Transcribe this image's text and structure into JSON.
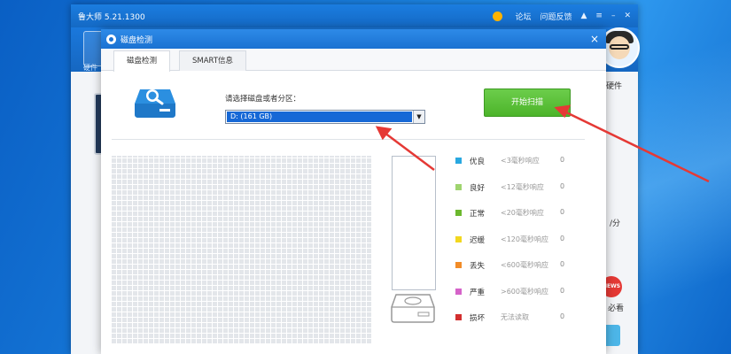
{
  "app": {
    "title": "鲁大师 5.21.1300",
    "controls": [
      "论坛",
      "问题反馈"
    ],
    "tile_label": "硬件",
    "side_texts": [
      "硬件",
      "/分",
      "必看"
    ],
    "news_label": "NEWS"
  },
  "dialog": {
    "title": "磁盘检测",
    "close": "×",
    "tabs": [
      {
        "label": "磁盘检测",
        "active": true
      },
      {
        "label": "SMART信息",
        "active": false
      }
    ],
    "select_label": "请选择磁盘或者分区：",
    "selected_disk": "D: (161 GB)",
    "scan_button": "开始扫描"
  },
  "legend": [
    {
      "name": "优良",
      "range": "<3毫秒响应",
      "count": "0",
      "color": "#29a8e0"
    },
    {
      "name": "良好",
      "range": "<12毫秒响应",
      "count": "0",
      "color": "#9fd46f"
    },
    {
      "name": "正常",
      "range": "<20毫秒响应",
      "count": "0",
      "color": "#6cb82e"
    },
    {
      "name": "迟缓",
      "range": "<120毫秒响应",
      "count": "0",
      "color": "#f2d71f"
    },
    {
      "name": "丢失",
      "range": "<600毫秒响应",
      "count": "0",
      "color": "#f28c28"
    },
    {
      "name": "严重",
      "range": ">600毫秒响应",
      "count": "0",
      "color": "#d563c9"
    },
    {
      "name": "损坏",
      "range": "无法读取",
      "count": "0",
      "color": "#d32f2f"
    }
  ],
  "colors": {
    "accent_blue": "#1b72d2",
    "scan_green": "#52b82f",
    "arrow_red": "#e53935"
  }
}
